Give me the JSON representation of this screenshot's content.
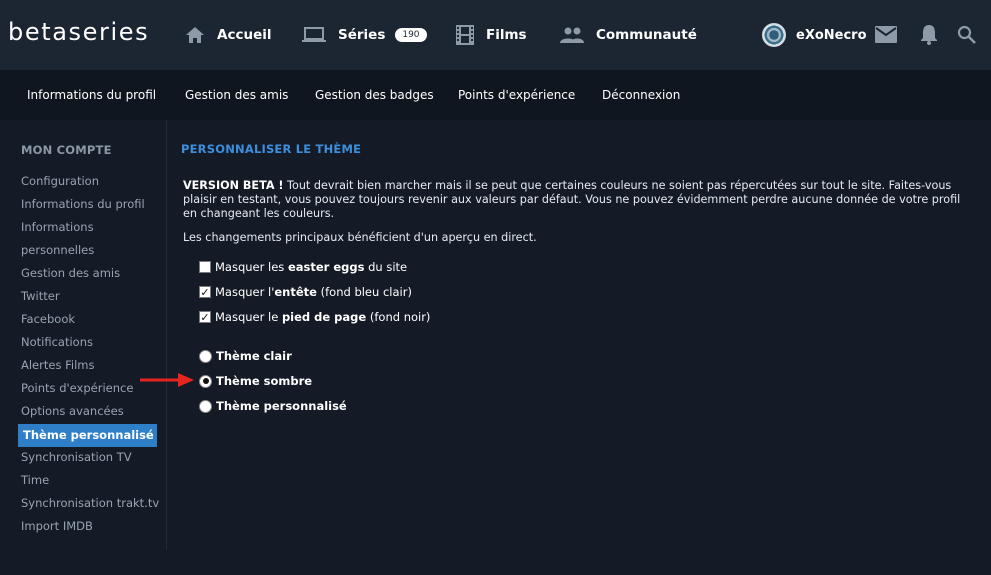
{
  "header": {
    "logo": "betaseries",
    "nav": [
      {
        "label": "Accueil",
        "icon": "home-icon"
      },
      {
        "label": "Séries",
        "icon": "laptop-icon",
        "badge": "190"
      },
      {
        "label": "Films",
        "icon": "film-icon"
      },
      {
        "label": "Communauté",
        "icon": "people-icon"
      }
    ],
    "user": {
      "name": "eXoNecro"
    },
    "icons": [
      "mail-icon",
      "bell-icon",
      "search-icon"
    ]
  },
  "subnav": [
    "Informations du profil",
    "Gestion des amis",
    "Gestion des badges",
    "Points d'expérience",
    "Déconnexion"
  ],
  "sidebar": {
    "heading": "MON COMPTE",
    "items": [
      "Configuration",
      "Informations du profil",
      "Informations",
      "personnelles",
      "Gestion des amis",
      "Twitter",
      "Facebook",
      "Notifications",
      "Alertes Films",
      "Points d'expérience",
      "Options avancées",
      "Thème personnalisé",
      "Synchronisation TV",
      "Time",
      "Synchronisation trakt.tv",
      "Import IMDB"
    ],
    "active_index": 11
  },
  "main": {
    "title": "PERSONNALISER LE THÈME",
    "beta_label": "VERSION BETA !",
    "beta_text": " Tout devrait bien marcher mais il se peut que certaines couleurs ne soient pas répercutées sur tout le site. Faites-vous plaisir en testant, vous pouvez toujours revenir aux valeurs par défaut. Vous ne pouvez évidemment perdre aucune donnée de votre profil en changeant les couleurs.",
    "preview_note": "Les changements principaux bénéficient d'un aperçu en direct.",
    "checkboxes": [
      {
        "pre": "Masquer les ",
        "bold": "easter eggs",
        "post": " du site",
        "checked": false
      },
      {
        "pre": "Masquer l'",
        "bold": "entête",
        "post": " (fond bleu clair)",
        "checked": true
      },
      {
        "pre": "Masquer le ",
        "bold": "pied de page",
        "post": " (fond noir)",
        "checked": true
      }
    ],
    "radios": [
      {
        "label": "Thème clair",
        "selected": false
      },
      {
        "label": "Thème sombre",
        "selected": true
      },
      {
        "label": "Thème personnalisé",
        "selected": false
      }
    ]
  },
  "colors": {
    "accent": "#2f7fc8",
    "title_blue": "#3d8fde",
    "arrow_red": "#e52420"
  }
}
